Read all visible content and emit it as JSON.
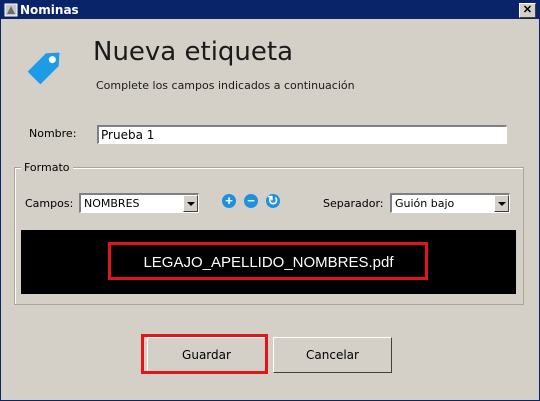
{
  "window": {
    "title": "Nominas",
    "close_glyph": "✕"
  },
  "header": {
    "title": "Nueva etiqueta",
    "subtitle": "Complete los campos indicados a continuación",
    "icon": "tag-icon"
  },
  "form": {
    "name_label": "Nombre:",
    "name_value": "Prueba 1"
  },
  "format": {
    "legend": "Formato",
    "fields_label": "Campos:",
    "fields_value": "NOMBRES",
    "separator_label": "Separador:",
    "separator_value": "Guión bajo",
    "add_glyph": "+",
    "remove_glyph": "−",
    "reset_glyph": "↻",
    "preview_text": "LEGAJO_APELLIDO_NOMBRES.pdf"
  },
  "buttons": {
    "save": "Guardar",
    "cancel": "Cancelar"
  },
  "colors": {
    "accent": "#1f8fe0",
    "highlight": "#e0161b",
    "titlebar": "#0a246a"
  }
}
